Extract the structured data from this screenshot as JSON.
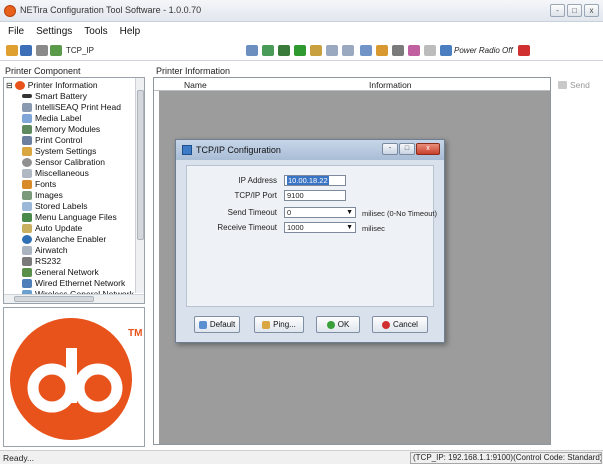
{
  "window": {
    "title": "NETira Configuration Tool Software - 1.0.0.70",
    "controls": [
      "-",
      "□",
      "x"
    ]
  },
  "menu": [
    "File",
    "Settings",
    "Tools",
    "Help"
  ],
  "toolbar": {
    "connection_label": "TCP_IP",
    "power_radio_label": "Power Radio Off"
  },
  "panes": {
    "printer_component_label": "Printer Component",
    "printer_information_label": "Printer Information"
  },
  "tree": {
    "root": "Printer Information",
    "items": [
      "Smart Battery",
      "IntelliSEAQ Print Head",
      "Media Label",
      "Memory Modules",
      "Print Control",
      "System Settings",
      "Sensor Calibration",
      "Miscellaneous",
      "Fonts",
      "Images",
      "Stored Labels",
      "Menu Language Files",
      "Auto Update",
      "Avalanche Enabler",
      "Airwatch",
      "RS232",
      "General Network",
      "Wired Ethernet Network",
      "Wireless General Network"
    ]
  },
  "logo": {
    "brand_color": "#e8531c",
    "tm": "TM"
  },
  "info_table": {
    "columns": [
      "Name",
      "Information"
    ]
  },
  "send_button": "Send",
  "dialog": {
    "title": "TCP/IP Configuration",
    "fields": {
      "ip_label": "IP Address",
      "ip_value": "10.00.18.22",
      "port_label": "TCP/IP Port",
      "port_value": "9100",
      "send_timeout_label": "Send Timeout",
      "send_timeout_value": "0",
      "send_timeout_hint": "milisec (0-No Timeout)",
      "receive_timeout_label": "Receive Timeout",
      "receive_timeout_value": "1000",
      "receive_timeout_hint": "milisec"
    },
    "buttons": {
      "default": "Default",
      "ping": "Ping...",
      "ok": "OK",
      "cancel": "Cancel"
    }
  },
  "status": {
    "left": "Ready...",
    "right": "(TCP_IP: 192.168.1.1:9100)(Control Code: Standard)"
  }
}
